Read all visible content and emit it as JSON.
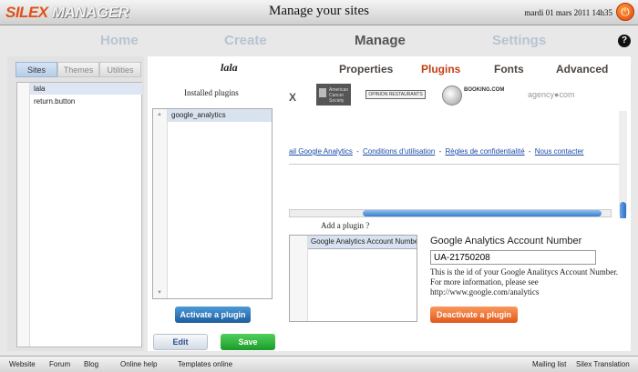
{
  "app": {
    "logo_part1": "SILEX",
    "logo_part2": "MANAGER",
    "window_title": "Manage your sites",
    "datetime": "mardi 01 mars 2011 14h35",
    "power_icon": "power-icon",
    "help_icon": "help-icon"
  },
  "nav": {
    "tabs": [
      {
        "label": "Home"
      },
      {
        "label": "Create"
      },
      {
        "label": "Manage",
        "active": true
      },
      {
        "label": "Settings"
      }
    ],
    "help_label": "?"
  },
  "left_panel": {
    "subtabs": [
      {
        "label": "Sites",
        "active": true
      },
      {
        "label": "Themes"
      },
      {
        "label": "Utilities"
      }
    ],
    "sites": [
      "lala",
      "return.button"
    ]
  },
  "main": {
    "site_name": "lala",
    "section_tabs": [
      {
        "label": "Properties"
      },
      {
        "label": "Plugins",
        "active": true
      },
      {
        "label": "Fonts"
      },
      {
        "label": "Advanced"
      }
    ],
    "installed_plugins_label": "Installed plugins",
    "installed_plugins": [
      "google_analytics"
    ],
    "activate_button": "Activate a plugin",
    "web_preview": {
      "logo_x": "X",
      "logo_cancer": "American Cancer Society",
      "logo_opinion": "OPINION RESTAURANTS",
      "logo_booking": "BOOKING.COM",
      "logo_agency": "agency●com",
      "links": [
        "ail Google Analytics",
        "Conditions d'utilisation",
        "Règles de confidentialité",
        "Nous contacter"
      ],
      "separator": "-"
    },
    "add_plugin_label": "Add a plugin ?",
    "plugin_fields": [
      "Google Analytics Account Number"
    ],
    "account_title": "Google Analytics Account Number",
    "account_value": "UA-21750208",
    "account_help": "This is the id of your Google Analitycs Account Number. For more information, please see http://www.google.com/analytics",
    "deactivate_button": "Deactivate a plugin",
    "edit_button": "Edit",
    "save_button": "Save"
  },
  "footer": {
    "links": [
      "Website",
      "Forum",
      "Blog",
      "Online help",
      "Templates online",
      "Mailing list",
      "Silex Translation"
    ]
  },
  "colors": {
    "accent_orange": "#e2571b",
    "active_tab": "#c24014",
    "nav_inactive": "#b8c4d2",
    "save_green": "#1c9a2a",
    "activate_blue": "#1c5d9e"
  }
}
